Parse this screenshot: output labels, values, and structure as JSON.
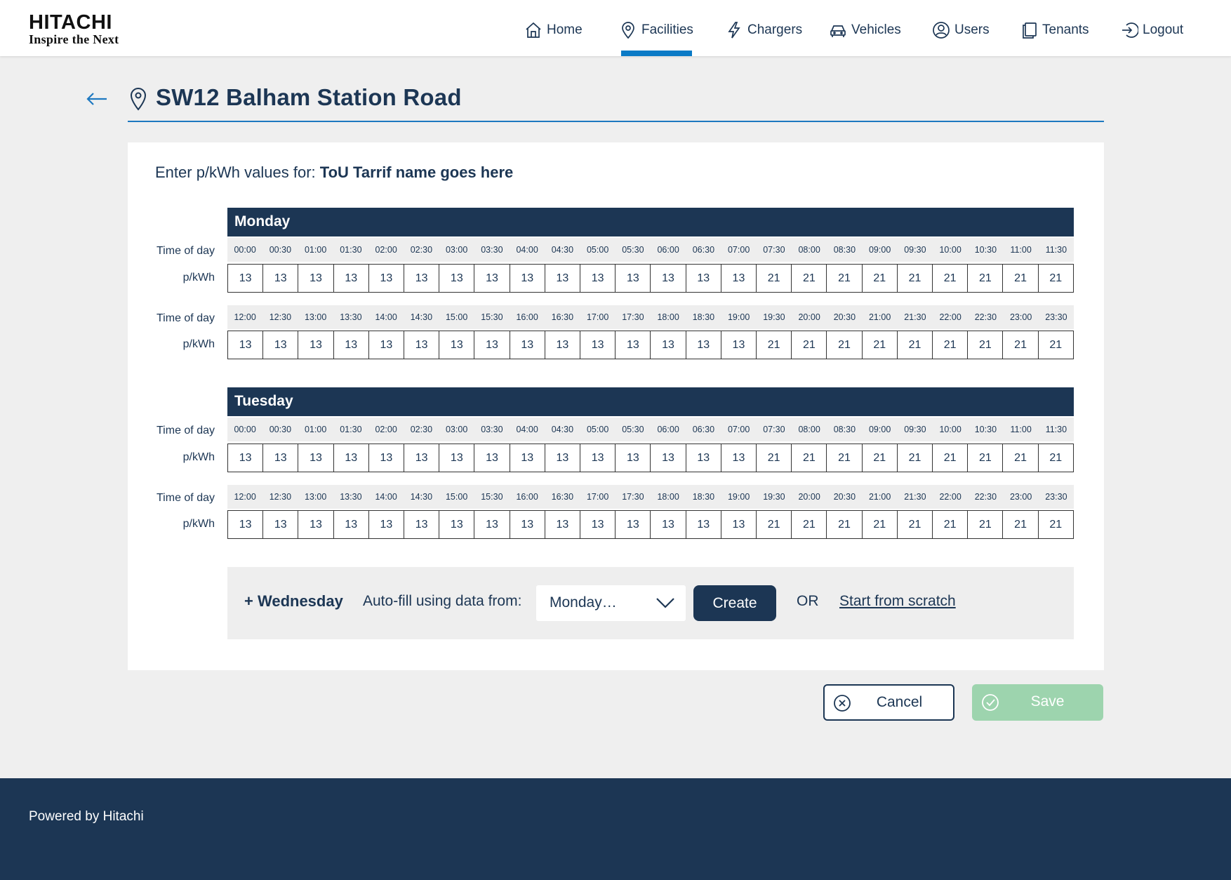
{
  "brand": {
    "name": "HITACHI",
    "tagline": "Inspire the Next"
  },
  "nav": {
    "home": "Home",
    "facilities": "Facilities",
    "chargers": "Chargers",
    "vehicles": "Vehicles",
    "users": "Users",
    "tenants": "Tenants",
    "logout": "Logout",
    "active": "Facilities"
  },
  "page": {
    "title": "SW12 Balham Station Road"
  },
  "form": {
    "intro_prefix": "Enter p/kWh values for:",
    "tariff_name": "ToU Tarrif name goes here",
    "time_label": "Time of day",
    "value_label": "p/kWh"
  },
  "days": [
    {
      "name": "Monday",
      "rows": [
        {
          "times": [
            "00:00",
            "00:30",
            "01:00",
            "01:30",
            "02:00",
            "02:30",
            "03:00",
            "03:30",
            "04:00",
            "04:30",
            "05:00",
            "05:30",
            "06:00",
            "06:30",
            "07:00",
            "07:30",
            "08:00",
            "08:30",
            "09:00",
            "09:30",
            "10:00",
            "10:30",
            "11:00",
            "11:30"
          ],
          "values": [
            "13",
            "13",
            "13",
            "13",
            "13",
            "13",
            "13",
            "13",
            "13",
            "13",
            "13",
            "13",
            "13",
            "13",
            "13",
            "21",
            "21",
            "21",
            "21",
            "21",
            "21",
            "21",
            "21",
            "21"
          ]
        },
        {
          "times": [
            "12:00",
            "12:30",
            "13:00",
            "13:30",
            "14:00",
            "14:30",
            "15:00",
            "15:30",
            "16:00",
            "16:30",
            "17:00",
            "17:30",
            "18:00",
            "18:30",
            "19:00",
            "19:30",
            "20:00",
            "20:30",
            "21:00",
            "21:30",
            "22:00",
            "22:30",
            "23:00",
            "23:30"
          ],
          "values": [
            "13",
            "13",
            "13",
            "13",
            "13",
            "13",
            "13",
            "13",
            "13",
            "13",
            "13",
            "13",
            "13",
            "13",
            "13",
            "21",
            "21",
            "21",
            "21",
            "21",
            "21",
            "21",
            "21",
            "21"
          ]
        }
      ]
    },
    {
      "name": "Tuesday",
      "rows": [
        {
          "times": [
            "00:00",
            "00:30",
            "01:00",
            "01:30",
            "02:00",
            "02:30",
            "03:00",
            "03:30",
            "04:00",
            "04:30",
            "05:00",
            "05:30",
            "06:00",
            "06:30",
            "07:00",
            "07:30",
            "08:00",
            "08:30",
            "09:00",
            "09:30",
            "10:00",
            "10:30",
            "11:00",
            "11:30"
          ],
          "values": [
            "13",
            "13",
            "13",
            "13",
            "13",
            "13",
            "13",
            "13",
            "13",
            "13",
            "13",
            "13",
            "13",
            "13",
            "13",
            "21",
            "21",
            "21",
            "21",
            "21",
            "21",
            "21",
            "21",
            "21"
          ]
        },
        {
          "times": [
            "12:00",
            "12:30",
            "13:00",
            "13:30",
            "14:00",
            "14:30",
            "15:00",
            "15:30",
            "16:00",
            "16:30",
            "17:00",
            "17:30",
            "18:00",
            "18:30",
            "19:00",
            "19:30",
            "20:00",
            "20:30",
            "21:00",
            "21:30",
            "22:00",
            "22:30",
            "23:00",
            "23:30"
          ],
          "values": [
            "13",
            "13",
            "13",
            "13",
            "13",
            "13",
            "13",
            "13",
            "13",
            "13",
            "13",
            "13",
            "13",
            "13",
            "13",
            "21",
            "21",
            "21",
            "21",
            "21",
            "21",
            "21",
            "21",
            "21"
          ]
        }
      ]
    }
  ],
  "add_day": {
    "label": "+ Wednesday",
    "autofill_label": "Auto-fill using data from:",
    "autofill_selected": "Monday…",
    "create_label": "Create",
    "or_label": "OR",
    "scratch_label": "Start from scratch"
  },
  "actions": {
    "cancel_label": "Cancel",
    "save_label": "Save"
  },
  "footer": {
    "text": "Powered by Hitachi"
  },
  "colors": {
    "navy": "#1c3654",
    "accent_blue": "#0a7ac6",
    "save_green": "#9dd4ae",
    "page_bg": "#efefef"
  }
}
